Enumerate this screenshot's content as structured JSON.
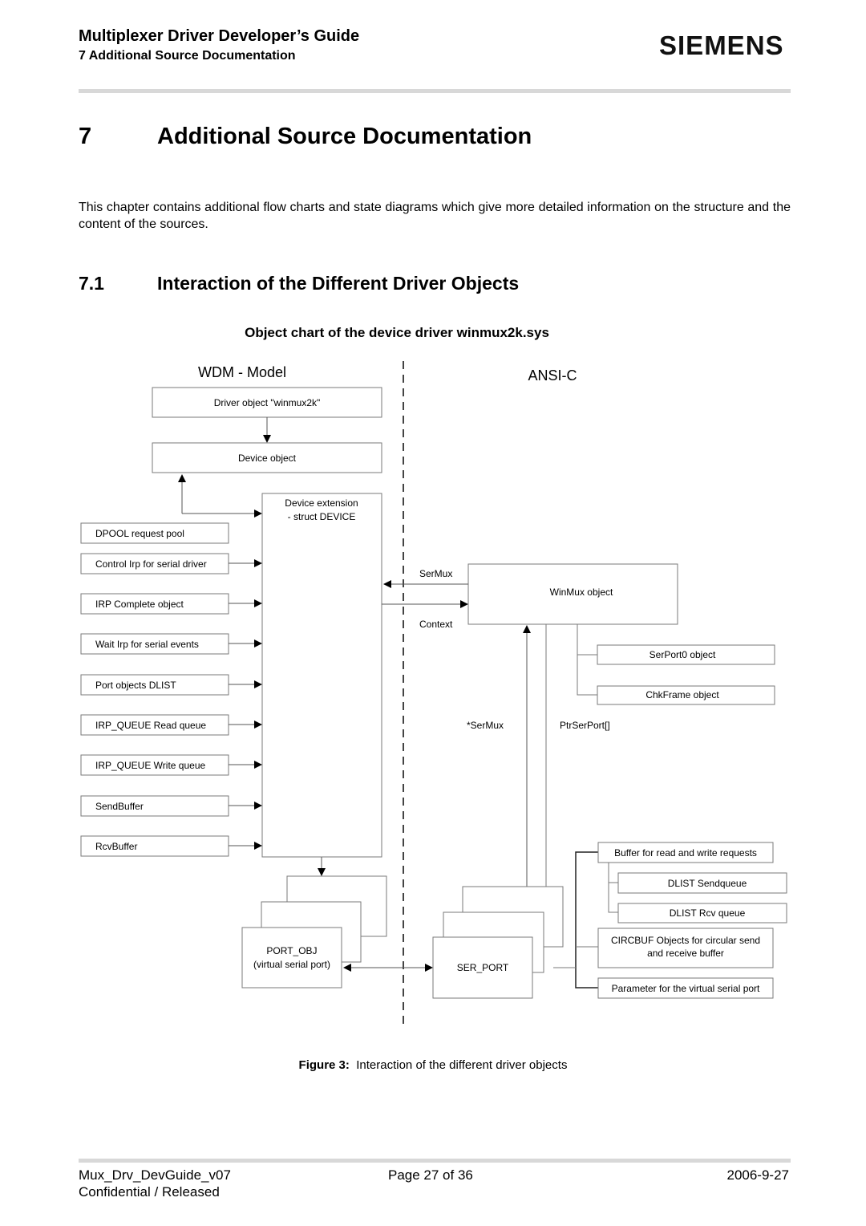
{
  "header": {
    "title": "Multiplexer Driver Developer’s Guide",
    "subtitle": "7 Additional Source Documentation",
    "logo": "SIEMENS"
  },
  "section": {
    "number": "7",
    "title": "Additional Source Documentation",
    "intro": "This chapter contains additional flow charts and state diagrams which give more detailed information on the structure and the content of the sources."
  },
  "subsection": {
    "number": "7.1",
    "title": "Interaction of the Different Driver Objects"
  },
  "diagram": {
    "title": "Object chart of the device driver winmux2k.sys",
    "left_heading": "WDM - Model",
    "right_heading": "ANSI-C",
    "driver_object": "Driver object \"winmux2k\"",
    "device_object": "Device object",
    "device_extension": [
      "Device extension",
      "- struct DEVICE"
    ],
    "extension_members": [
      "DPOOL request pool",
      "Control Irp for serial driver",
      "IRP Complete object",
      "Wait Irp for serial events",
      "Port objects DLIST",
      "IRP_QUEUE Read queue",
      "IRP_QUEUE Write queue",
      "SendBuffer",
      "RcvBuffer"
    ],
    "winmux_object": "WinMux object",
    "label_sermux": "SerMux",
    "label_context": "Context",
    "label_sermux_ptr": "*SerMux",
    "label_ptrserport": "PtrSerPort[]",
    "serport0": "SerPort0 object",
    "chkframe": "ChkFrame object",
    "port_obj": [
      "PORT_OBJ",
      "(virtual serial port)"
    ],
    "ser_port": "SER_PORT",
    "ser_port_members": {
      "buffer": "Buffer for read and write requests",
      "sendqueue": "DLIST Sendqueue",
      "rcvqueue": "DLIST Rcv queue",
      "circbuf": [
        "CIRCBUF Objects for circular send",
        "and receive buffer"
      ],
      "param": "Parameter for the virtual serial port"
    }
  },
  "figure": {
    "label": "Figure 3:",
    "caption": "Interaction of the different driver objects"
  },
  "footer": {
    "doc": "Mux_Drv_DevGuide_v07",
    "page": "Page 27 of 36",
    "date": "2006-9-27",
    "status": "Confidential / Released"
  }
}
